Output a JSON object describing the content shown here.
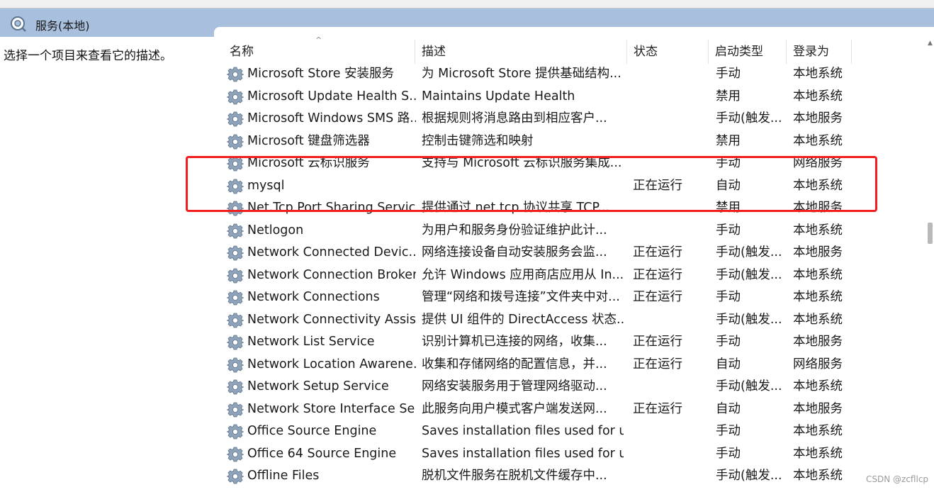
{
  "header": {
    "title": "服务(本地)",
    "icon": "services-gear-icon"
  },
  "left_pane": {
    "description": "选择一个项目来查看它的描述。"
  },
  "columns": {
    "name": "名称",
    "description": "描述",
    "status": "状态",
    "startup_type": "启动类型",
    "log_on_as": "登录为"
  },
  "sort_indicator": "^",
  "services": [
    {
      "name": "Microsoft Store 安装服务",
      "description": "为 Microsoft Store 提供基础结构...",
      "status": "",
      "startup_type": "手动",
      "log_on_as": "本地系统"
    },
    {
      "name": "Microsoft Update Health S...",
      "description": "Maintains Update Health",
      "status": "",
      "startup_type": "禁用",
      "log_on_as": "本地系统"
    },
    {
      "name": "Microsoft Windows SMS 路...",
      "description": "根据规则将消息路由到相应客户...",
      "status": "",
      "startup_type": "手动(触发...",
      "log_on_as": "本地服务"
    },
    {
      "name": "Microsoft 键盘筛选器",
      "description": "控制击键筛选和映射",
      "status": "",
      "startup_type": "禁用",
      "log_on_as": "本地系统"
    },
    {
      "name": "Microsoft 云标识服务",
      "description": "支持与 Microsoft 云标识服务集成...",
      "status": "",
      "startup_type": "手动",
      "log_on_as": "网络服务"
    },
    {
      "name": "mysql",
      "description": "",
      "status": "正在运行",
      "startup_type": "自动",
      "log_on_as": "本地系统"
    },
    {
      "name": "Net.Tcp Port Sharing Service",
      "description": "提供通过 net.tcp 协议共享 TCP...",
      "status": "",
      "startup_type": "禁用",
      "log_on_as": "本地服务"
    },
    {
      "name": "Netlogon",
      "description": "为用户和服务身份验证维护此计...",
      "status": "",
      "startup_type": "手动",
      "log_on_as": "本地系统"
    },
    {
      "name": "Network Connected Devic...",
      "description": "网络连接设备自动安装服务会监...",
      "status": "正在运行",
      "startup_type": "手动(触发...",
      "log_on_as": "本地服务"
    },
    {
      "name": "Network Connection Broker",
      "description": "允许 Windows 应用商店应用从 In...",
      "status": "正在运行",
      "startup_type": "手动(触发...",
      "log_on_as": "本地系统"
    },
    {
      "name": "Network Connections",
      "description": "管理“网络和拨号连接”文件夹中对...",
      "status": "正在运行",
      "startup_type": "手动",
      "log_on_as": "本地系统"
    },
    {
      "name": "Network Connectivity Assis...",
      "description": "提供 UI 组件的 DirectAccess 状态...",
      "status": "",
      "startup_type": "手动(触发...",
      "log_on_as": "本地系统"
    },
    {
      "name": "Network List Service",
      "description": "识别计算机已连接的网络，收集...",
      "status": "正在运行",
      "startup_type": "手动",
      "log_on_as": "本地服务"
    },
    {
      "name": "Network Location Awarene...",
      "description": "收集和存储网络的配置信息，并...",
      "status": "正在运行",
      "startup_type": "自动",
      "log_on_as": "网络服务"
    },
    {
      "name": "Network Setup Service",
      "description": "网络安装服务用于管理网络驱动...",
      "status": "",
      "startup_type": "手动(触发...",
      "log_on_as": "本地系统"
    },
    {
      "name": "Network Store Interface Se...",
      "description": "此服务向用户模式客户端发送网...",
      "status": "正在运行",
      "startup_type": "自动",
      "log_on_as": "本地服务"
    },
    {
      "name": "Office  Source Engine",
      "description": "Saves installation files used for u...",
      "status": "",
      "startup_type": "手动",
      "log_on_as": "本地系统"
    },
    {
      "name": "Office 64 Source Engine",
      "description": "Saves installation files used for u...",
      "status": "",
      "startup_type": "手动",
      "log_on_as": "本地系统"
    },
    {
      "name": "Offline Files",
      "description": "脱机文件服务在脱机文件缓存中...",
      "status": "",
      "startup_type": "手动(触发...",
      "log_on_as": "本地系统"
    }
  ],
  "watermark": "CSDN @zcfllcp",
  "colors": {
    "header_band": "#a8c0dd",
    "highlight_box": "#f01e1e",
    "gear_icon": "#7a8fa6"
  }
}
